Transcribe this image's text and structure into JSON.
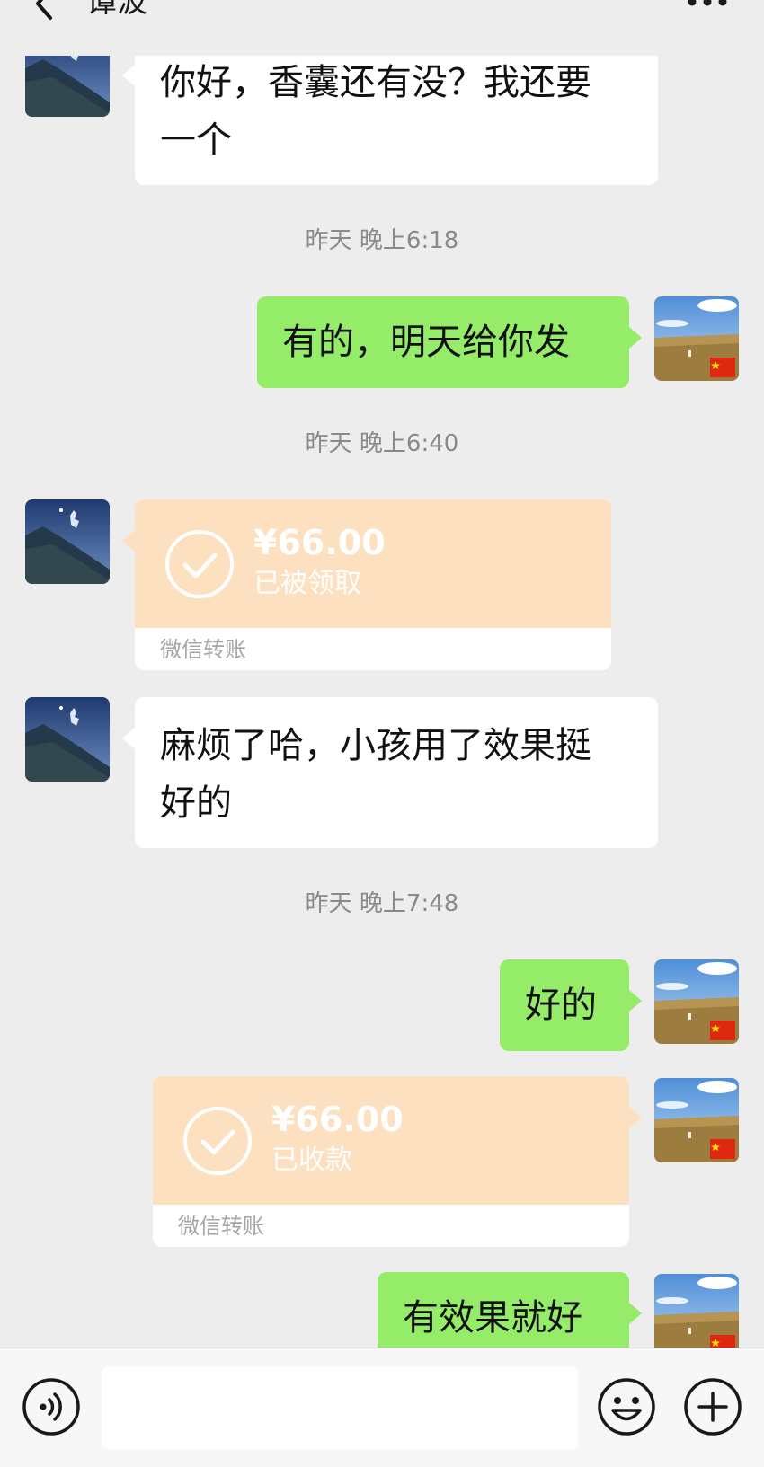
{
  "header": {
    "title": "谭波",
    "back_icon": "chevron-left-icon",
    "more_icon": "more-dots-icon"
  },
  "messages": {
    "m1": {
      "text_line1": "你好，香囊还有没？我还要",
      "text_line2": "一个"
    },
    "t1": "昨天 晚上6:18",
    "m2": {
      "text": "有的，明天给你发"
    },
    "t2": "昨天 晚上6:40",
    "tr1": {
      "amount": "¥66.00",
      "status": "已被领取",
      "label": "微信转账"
    },
    "m3": {
      "text_line1": "麻烦了哈，小孩用了效果挺",
      "text_line2": "好的"
    },
    "t3": "昨天 晚上7:48",
    "m4": {
      "text": "好的"
    },
    "tr2": {
      "amount": "¥66.00",
      "status": "已收款",
      "label": "微信转账"
    },
    "m5": {
      "text": "有效果就好"
    }
  },
  "input": {
    "value": "",
    "placeholder": ""
  },
  "icons": {
    "voice": "voice-icon",
    "emoji": "emoji-icon",
    "plus": "plus-icon"
  },
  "colors": {
    "background": "#ededed",
    "self_bubble": "#95ec69",
    "other_bubble": "#ffffff",
    "transfer": "#fce0c0",
    "timestamp": "#8a8a8a"
  }
}
